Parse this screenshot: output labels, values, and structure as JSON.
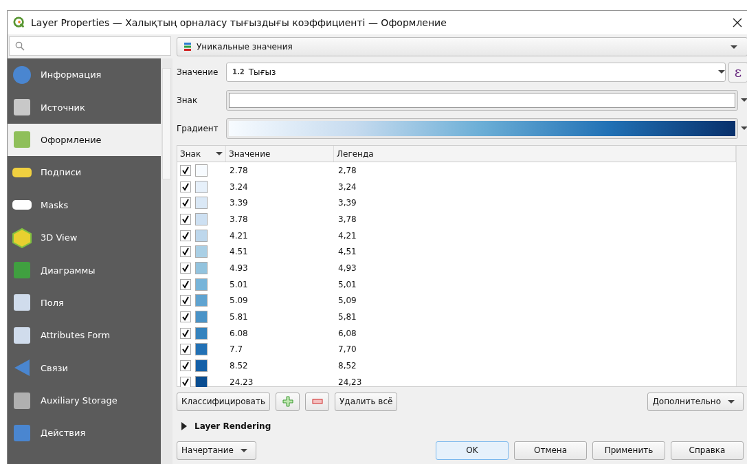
{
  "window": {
    "title": "Layer Properties — Халықтың орналасу тығыздығы коэффициенті — Оформление"
  },
  "sidebar": {
    "items": [
      {
        "label": "Информация",
        "selected": false
      },
      {
        "label": "Источник",
        "selected": false
      },
      {
        "label": "Оформление",
        "selected": true
      },
      {
        "label": "Подписи",
        "selected": false
      },
      {
        "label": "Masks",
        "selected": false
      },
      {
        "label": "3D View",
        "selected": false
      },
      {
        "label": "Диаграммы",
        "selected": false
      },
      {
        "label": "Поля",
        "selected": false
      },
      {
        "label": "Attributes Form",
        "selected": false
      },
      {
        "label": "Связи",
        "selected": false
      },
      {
        "label": "Auxiliary Storage",
        "selected": false
      },
      {
        "label": "Действия",
        "selected": false
      }
    ]
  },
  "renderer": {
    "value": "Уникальные значения"
  },
  "value_row": {
    "label": "Значение",
    "type_badge": "1.2",
    "value": "Тығыз",
    "expression_button": "ε"
  },
  "symbol_row": {
    "label": "Знак"
  },
  "gradient_row": {
    "label": "Градиент"
  },
  "table": {
    "columns": [
      "Знак",
      "Значение",
      "Легенда"
    ],
    "rows": [
      {
        "checked": true,
        "color": "#f7fbff",
        "value": "2.78",
        "legend": "2,78"
      },
      {
        "checked": true,
        "color": "#e6f0fa",
        "value": "3.24",
        "legend": "3,24"
      },
      {
        "checked": true,
        "color": "#dae8f6",
        "value": "3.39",
        "legend": "3,39"
      },
      {
        "checked": true,
        "color": "#cde0f2",
        "value": "3.78",
        "legend": "3,78"
      },
      {
        "checked": true,
        "color": "#bdd7ec",
        "value": "4.21",
        "legend": "4,21"
      },
      {
        "checked": true,
        "color": "#a9cfe5",
        "value": "4.51",
        "legend": "4,51"
      },
      {
        "checked": true,
        "color": "#92c3de",
        "value": "4.93",
        "legend": "4,93"
      },
      {
        "checked": true,
        "color": "#77b4d9",
        "value": "5.01",
        "legend": "5,01"
      },
      {
        "checked": true,
        "color": "#5fa3d0",
        "value": "5.09",
        "legend": "5,09"
      },
      {
        "checked": true,
        "color": "#4a93c7",
        "value": "5.81",
        "legend": "5,81"
      },
      {
        "checked": true,
        "color": "#3583be",
        "value": "6.08",
        "legend": "6,08"
      },
      {
        "checked": true,
        "color": "#2271b5",
        "value": "7.7",
        "legend": "7,70"
      },
      {
        "checked": true,
        "color": "#1460a8",
        "value": "8.52",
        "legend": "8,52"
      },
      {
        "checked": true,
        "color": "#094d91",
        "value": "24.23",
        "legend": "24,23"
      }
    ]
  },
  "actions": {
    "classify": "Классифицировать",
    "delete_all": "Удалить всё",
    "advanced": "Дополнительно"
  },
  "layer_rendering": {
    "label": "Layer Rendering",
    "expanded": false
  },
  "footer": {
    "style": "Начертание",
    "buttons": [
      "OK",
      "Отмена",
      "Применить",
      "Справка"
    ]
  }
}
